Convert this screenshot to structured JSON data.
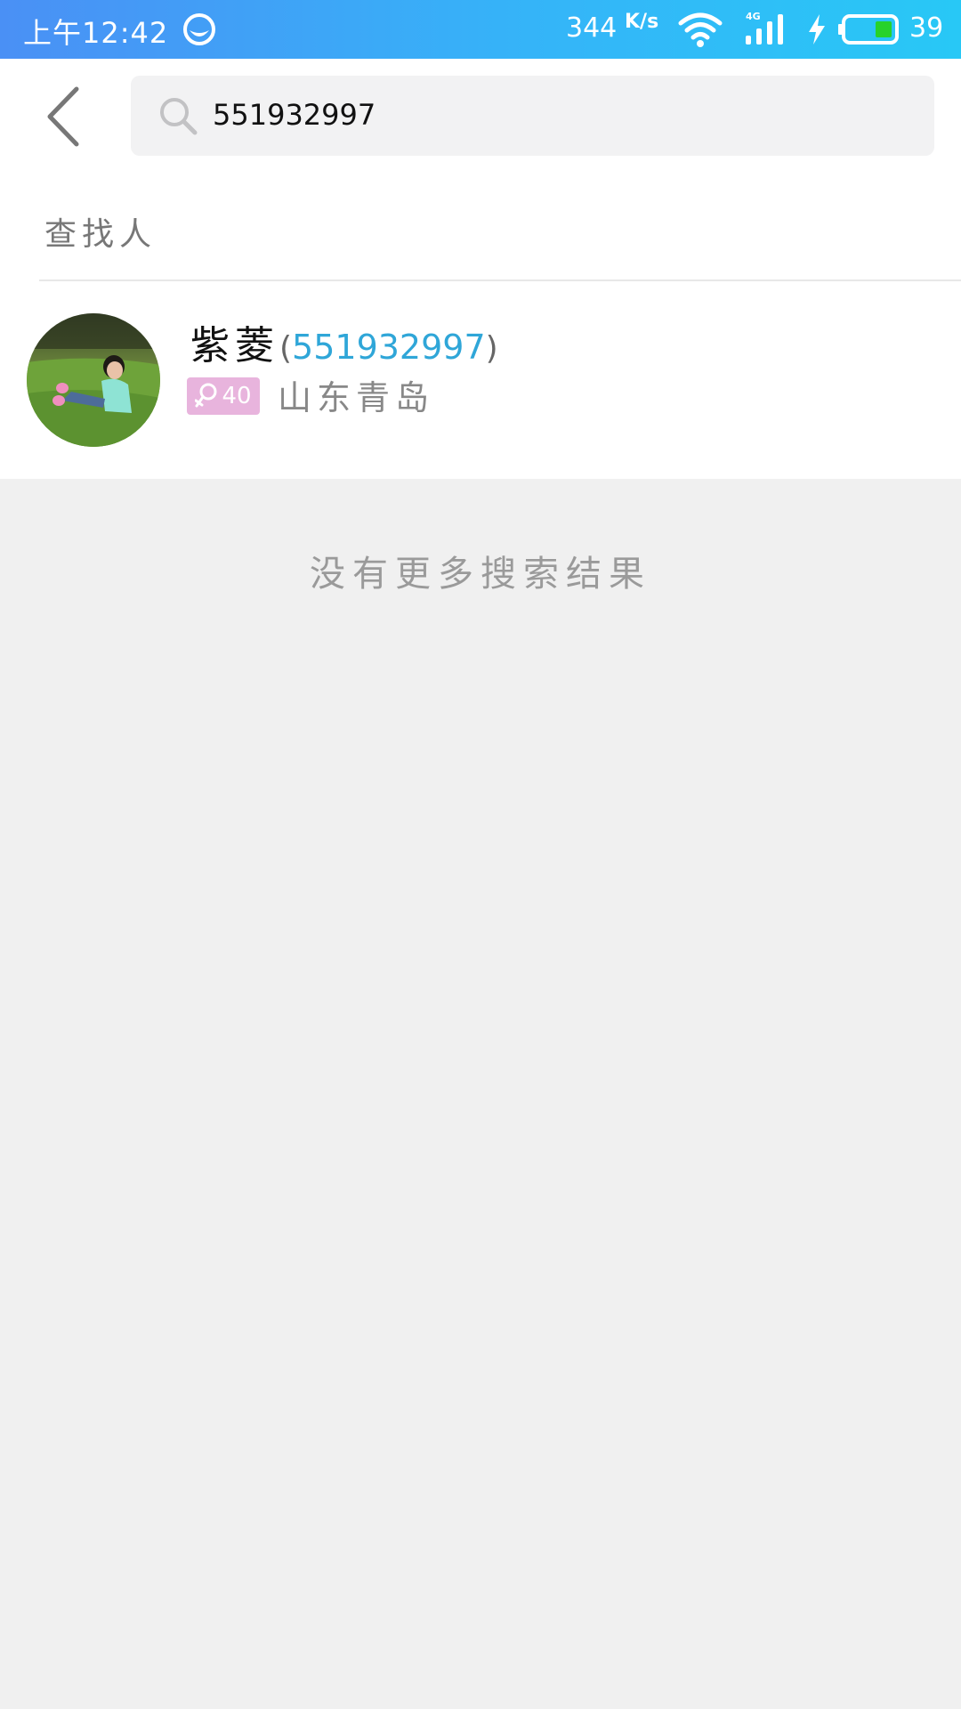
{
  "status_bar": {
    "time": "上午12:42",
    "net_speed": "344",
    "net_speed_unit": "K/s",
    "network_type": "4G",
    "battery_level": "39",
    "icons": [
      "app-notification-icon",
      "wifi-icon",
      "signal-icon",
      "charging-icon",
      "battery-icon"
    ]
  },
  "search": {
    "query": "551932997"
  },
  "section": {
    "title": "查找人"
  },
  "results": [
    {
      "name": "紫菱",
      "id": "551932997",
      "age": "40",
      "gender": "female",
      "location": "山东青岛"
    }
  ],
  "footer": {
    "no_more_text": "没有更多搜索结果"
  },
  "colors": {
    "status_gradient_start": "#4a90f5",
    "status_gradient_end": "#28c8f6",
    "id_link": "#2fa6d8",
    "female_badge": "#e8b4dd",
    "background": "#f0f0f0"
  }
}
